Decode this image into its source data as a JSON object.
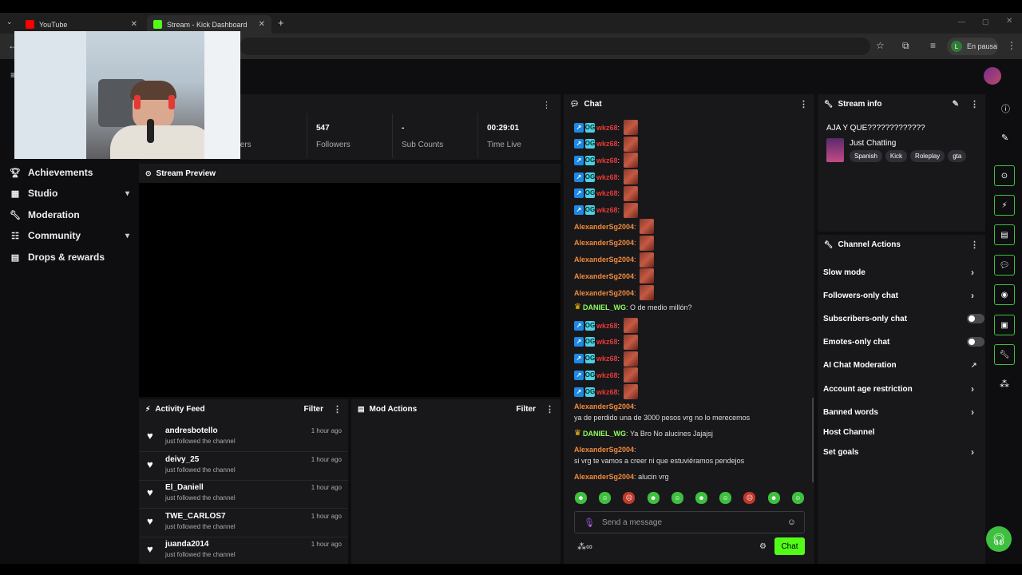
{
  "browser": {
    "tabs": [
      {
        "label": "YouTube",
        "favicon_color": "#ff0000"
      },
      {
        "label": "Stream - Kick Dashboard",
        "favicon_color": "#53fc18"
      }
    ],
    "profile_label": "En pausa",
    "profile_initial": "L"
  },
  "sidebar": {
    "items": [
      {
        "label": "Achievements",
        "icon": "trophy-icon",
        "chevron": false
      },
      {
        "label": "Studio",
        "icon": "studio-icon",
        "chevron": true
      },
      {
        "label": "Moderation",
        "icon": "wrench-icon",
        "chevron": false
      },
      {
        "label": "Community",
        "icon": "community-icon",
        "chevron": true
      },
      {
        "label": "Drops & rewards",
        "icon": "gift-icon",
        "chevron": false
      }
    ]
  },
  "stats": {
    "viewers_label": "ewers",
    "followers_value": "547",
    "followers_label": "Followers",
    "subs_value": "-",
    "subs_label": "Sub Counts",
    "time_value": "00:29:01",
    "time_label": "Time Live"
  },
  "stream_preview": {
    "title": "Stream Preview"
  },
  "activity_feed": {
    "title": "Activity Feed",
    "filter_label": "Filter",
    "items": [
      {
        "name": "andresbotello",
        "sub": "just followed the channel",
        "time": "1 hour ago"
      },
      {
        "name": "deivy_25",
        "sub": "just followed the channel",
        "time": "1 hour ago"
      },
      {
        "name": "El_Daniell",
        "sub": "just followed the channel",
        "time": "1 hour ago"
      },
      {
        "name": "TWE_CARLOS7",
        "sub": "just followed the channel",
        "time": "1 hour ago"
      },
      {
        "name": "juanda2014",
        "sub": "just followed the channel",
        "time": "1 hour ago"
      }
    ]
  },
  "mod_actions": {
    "title": "Mod Actions",
    "filter_label": "Filter"
  },
  "chat": {
    "title": "Chat",
    "messages": [
      {
        "user": "wkz68",
        "text": "",
        "style": "red",
        "badges": true,
        "emote": true
      },
      {
        "user": "wkz68",
        "text": "",
        "style": "red",
        "badges": true,
        "emote": true
      },
      {
        "user": "wkz68",
        "text": "",
        "style": "red",
        "badges": true,
        "emote": true
      },
      {
        "user": "wkz68",
        "text": "",
        "style": "red",
        "badges": true,
        "emote": true
      },
      {
        "user": "wkz68",
        "text": "",
        "style": "red",
        "badges": true,
        "emote": true
      },
      {
        "user": "wkz68",
        "text": "",
        "style": "red",
        "badges": true,
        "emote": true
      },
      {
        "user": "AlexanderSg2004",
        "text": "",
        "style": "orange",
        "badges": false,
        "emote": true
      },
      {
        "user": "AlexanderSg2004",
        "text": "",
        "style": "orange",
        "badges": false,
        "emote": true
      },
      {
        "user": "AlexanderSg2004",
        "text": "",
        "style": "orange",
        "badges": false,
        "emote": true
      },
      {
        "user": "AlexanderSg2004",
        "text": "",
        "style": "orange",
        "badges": false,
        "emote": true
      },
      {
        "user": "AlexanderSg2004",
        "text": "",
        "style": "orange",
        "badges": false,
        "emote": true
      },
      {
        "user": "DANIEL_WG",
        "text": "O de medio millón?",
        "style": "green",
        "crown": true
      },
      {
        "user": "wkz68",
        "text": "",
        "style": "red",
        "badges": true,
        "emote": true
      },
      {
        "user": "wkz68",
        "text": "",
        "style": "red",
        "badges": true,
        "emote": true
      },
      {
        "user": "wkz68",
        "text": "",
        "style": "red",
        "badges": true,
        "emote": true
      },
      {
        "user": "wkz68",
        "text": "",
        "style": "red",
        "badges": true,
        "emote": true
      },
      {
        "user": "wkz68",
        "text": "",
        "style": "red",
        "badges": true,
        "emote": true
      },
      {
        "user": "AlexanderSg2004",
        "text": "ya de perdido una de 3000 pesos vrg no lo merecemos",
        "style": "orange"
      },
      {
        "user": "DANIEL_WG",
        "text": "Ya Bro No alucines Jajajsj",
        "style": "green",
        "crown": true
      },
      {
        "user": "AlexanderSg2004",
        "text": "si vrg te vamos a creer ni que estuviéramos pendejos",
        "style": "orange"
      },
      {
        "user": "AlexanderSg2004",
        "text": "alucin vrg",
        "style": "orange"
      }
    ],
    "input_placeholder": "Send a message",
    "send_label": "Chat"
  },
  "stream_info": {
    "title_header": "Stream info",
    "stream_title": "AJA Y QUE?????????????",
    "category": "Just Chatting",
    "tags": [
      "Spanish",
      "Kick",
      "Roleplay",
      "gta"
    ]
  },
  "channel_actions": {
    "title": "Channel Actions",
    "items": [
      {
        "label": "Slow mode",
        "control": "chevron"
      },
      {
        "label": "Followers-only chat",
        "control": "chevron"
      },
      {
        "label": "Subscribers-only chat",
        "control": "toggle",
        "enabled": false
      },
      {
        "label": "Emotes-only chat",
        "control": "toggle",
        "enabled": false
      },
      {
        "label": "AI Chat Moderation",
        "control": "external"
      },
      {
        "label": "Account age restriction",
        "control": "chevron"
      },
      {
        "label": "Banned words",
        "control": "chevron"
      },
      {
        "label": "Host Channel",
        "control": "none"
      },
      {
        "label": "Set goals",
        "control": "chevron"
      }
    ]
  },
  "colors": {
    "accent": "#53fc18",
    "panel": "#18181b",
    "bg": "#0e0e10"
  }
}
